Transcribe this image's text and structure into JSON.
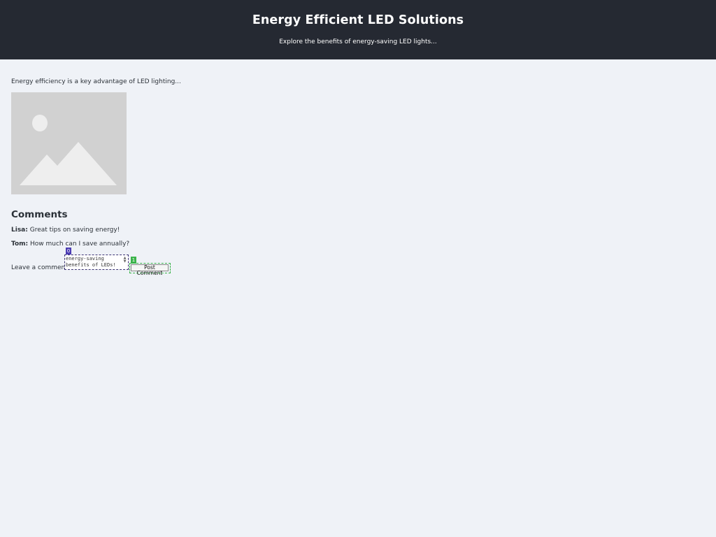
{
  "header": {
    "title": "Energy Efficient LED Solutions",
    "subtitle": "Explore the benefits of energy-saving LED lights..."
  },
  "main": {
    "intro": "Energy efficiency is a key advantage of LED lighting...",
    "image_icon": "image-placeholder-icon"
  },
  "comments": {
    "heading": "Comments",
    "items": [
      {
        "author": "Lisa:",
        "text": "Great tips on saving energy!"
      },
      {
        "author": "Tom:",
        "text": "How much can I save annually?"
      }
    ],
    "form": {
      "label": "Leave a comment:",
      "value": "energy-saving benefits of LEDs!",
      "post_label": "Post Comment",
      "markers": [
        "0",
        "1"
      ]
    }
  },
  "colors": {
    "header_bg": "#252932",
    "page_bg": "#eff2f7",
    "marker_textarea": "#4b3cb3",
    "marker_button": "#3ab34a"
  }
}
